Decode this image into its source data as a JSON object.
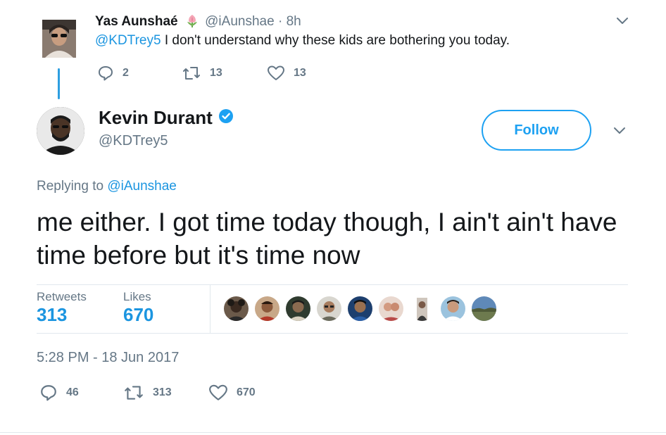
{
  "parent_tweet": {
    "name": "Yas Aunshaé",
    "handle": "@iAunshae",
    "separator": "·",
    "time": "8h",
    "mention": "@KDTrey5",
    "text": "I don't understand why these kids are bothering you today.",
    "replies": "2",
    "retweets": "13",
    "likes": "13"
  },
  "main_tweet": {
    "name": "Kevin Durant",
    "handle": "@KDTrey5",
    "follow_label": "Follow",
    "replying_prefix": "Replying to",
    "replying_to": "@iAunshae",
    "text": "me either. I got time today though, I ain't ain't have time before but it's time now",
    "stats": {
      "retweets_label": "Retweets",
      "retweets_value": "313",
      "likes_label": "Likes",
      "likes_value": "670"
    },
    "timestamp": "5:28 PM - 18 Jun 2017",
    "actions": {
      "replies": "46",
      "retweets": "313",
      "likes": "670"
    }
  },
  "icons": {
    "name_emoji": "tulip-icon",
    "verified": "verified-badge-icon",
    "reply": "reply-icon",
    "retweet": "retweet-icon",
    "like": "heart-icon",
    "caret": "chevron-down-icon"
  },
  "colors": {
    "accent": "#1da1f2",
    "link": "#1b95e0",
    "secondary_text": "#657786",
    "thread_line": "#2d9ee0"
  }
}
